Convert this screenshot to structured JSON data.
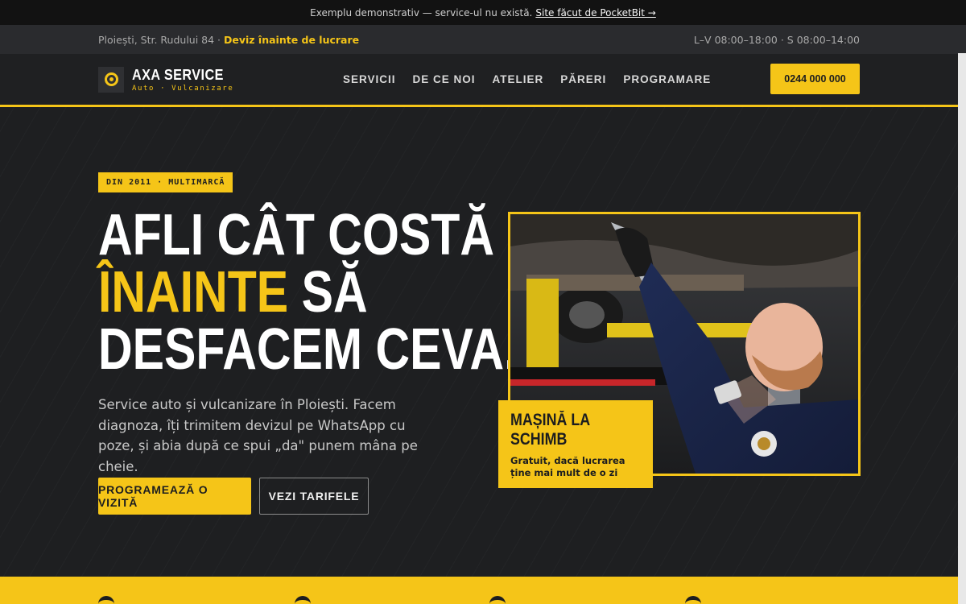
{
  "notice": {
    "text": "Exemplu demonstrativ — service-ul nu există.",
    "link": "Site făcut de PocketBit →"
  },
  "info_bar": {
    "address": "Ploiești, Str. Rudului 84 · ",
    "highlight": "Deviz înainte de lucrare",
    "hours": "L–V 08:00–18:00 · S 08:00–14:00"
  },
  "brand": {
    "name": "AXA SERVICE",
    "tagline": "Auto · Vulcanizare",
    "icon": "target-icon"
  },
  "nav": {
    "items": [
      "SERVICII",
      "DE CE NOI",
      "ATELIER",
      "PĂRERI",
      "PROGRAMARE"
    ],
    "phone": "0244 000 000"
  },
  "hero": {
    "tag": "DIN 2011 · MULTIMARCĂ",
    "line1": "AFLI CÂT COSTĂ",
    "line2_highlight": "ÎNAINTE",
    "line2_rest": " SĂ",
    "line3": "DESFACEM CEVA.",
    "lede": "Service auto și vulcanizare în Ploiești. Facem diagnoza, îți trimitem devizul pe WhatsApp cu poze, și abia după ce spui „da\" punem mâna pe cheie.",
    "cta_primary": "PROGRAMEAZĂ O VIZITĂ",
    "cta_secondary": "VEZI TARIFELE"
  },
  "badge": {
    "title": "MAȘINĂ LA SCHIMB",
    "subtitle": "Gratuit, dacă lucrarea ține mai mult de o zi"
  },
  "colors": {
    "accent": "#f5c518",
    "background": "#1e1f21",
    "nav": "#1f2022"
  }
}
